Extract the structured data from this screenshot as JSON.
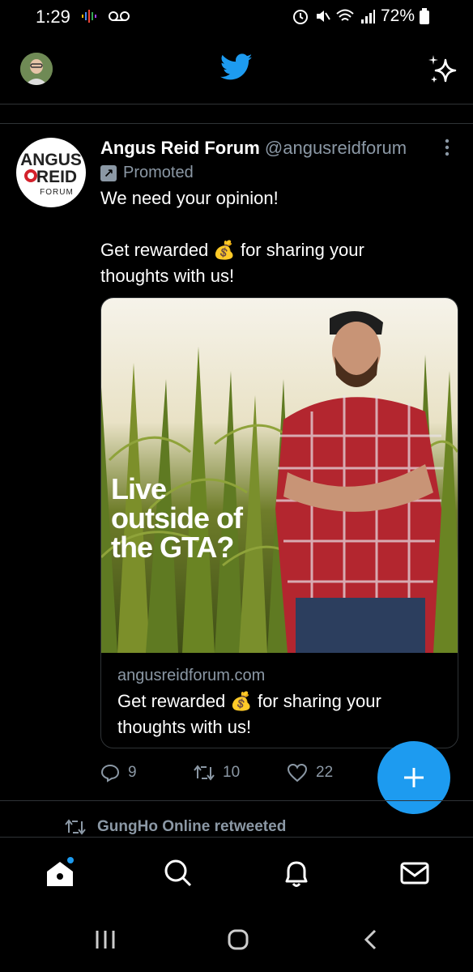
{
  "status_bar": {
    "time": "1:29",
    "battery": "72%"
  },
  "header": {
    "avatar_icon": "user-avatar",
    "logo_icon": "twitter-bird-icon",
    "sparkle_icon": "sparkle-icon"
  },
  "tweet": {
    "author_name": "Angus Reid Forum",
    "author_handle": "@angusreidforum",
    "promoted_label": "Promoted",
    "logo_text": {
      "line1": "ANGUS",
      "line2": "REID",
      "line3": "FORUM"
    },
    "text_line1": "We need your opinion!",
    "text_line2a": "Get rewarded",
    "text_line2b": "for sharing your",
    "text_line3": "thoughts with us!",
    "emoji": "💰",
    "card": {
      "overlay_line1": "Live",
      "overlay_line2": "outside of",
      "overlay_line3": "the GTA?",
      "domain": "angusreidforum.com",
      "title_a": "Get rewarded",
      "title_b": "for sharing your",
      "title_c": "thoughts with us!"
    },
    "replies": "9",
    "retweets": "10",
    "likes": "22"
  },
  "next_item": {
    "retweet_context": "GungHo Online retweeted"
  },
  "colors": {
    "accent": "#1d9bf0",
    "muted": "#8b98a5",
    "divider": "#2f3336"
  }
}
